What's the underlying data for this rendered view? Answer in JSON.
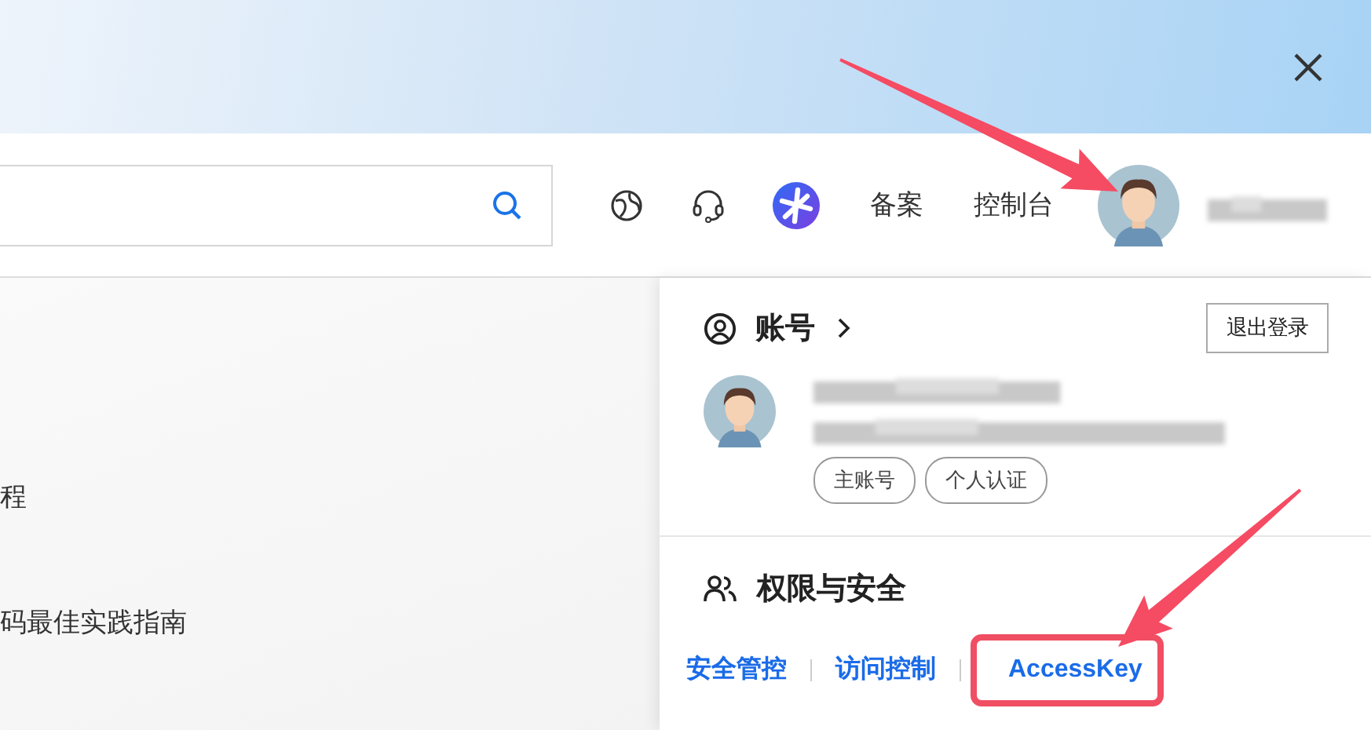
{
  "header": {
    "nav": [
      {
        "label": "备案"
      },
      {
        "label": "控制台"
      }
    ]
  },
  "left_content": [
    {
      "text": "程"
    },
    {
      "text": "码最佳实践指南"
    }
  ],
  "account_panel": {
    "title": "账号",
    "logout_button": "退出登录",
    "tags": [
      "主账号",
      "个人认证"
    ],
    "security": {
      "title": "权限与安全",
      "links": [
        {
          "label": "安全管控",
          "highlighted": false
        },
        {
          "label": "访问控制",
          "highlighted": false
        },
        {
          "label": "AccessKey",
          "highlighted": true
        }
      ]
    }
  }
}
